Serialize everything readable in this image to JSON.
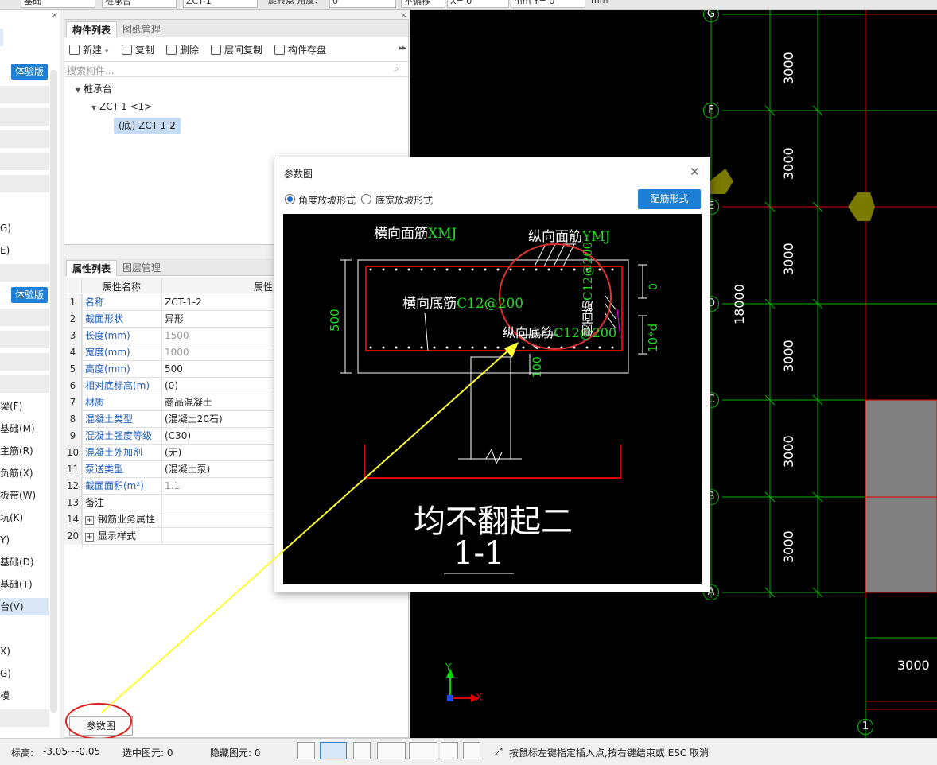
{
  "topbar": {
    "fields": [
      "基础",
      "桩承台",
      "ZCT-1",
      "旋转点 角度:",
      "0",
      "不偏移",
      "X= 0",
      "mm Y= 0",
      "mm"
    ]
  },
  "leftnav": {
    "badge": "体验版",
    "items": [
      "G)",
      "E)",
      "梁(F)",
      "基础(M)",
      "主筋(R)",
      "负筋(X)",
      "板带(W)",
      "坑(K)",
      "Y)",
      "基础(D)",
      "基础(T)",
      "台(V)",
      "X)",
      "G)",
      "模"
    ]
  },
  "component_panel": {
    "tabs": [
      "构件列表",
      "图纸管理"
    ],
    "toolbar": {
      "new": "新建",
      "copy": "复制",
      "delete": "删除",
      "floor_copy": "层间复制",
      "save": "构件存盘"
    },
    "search_placeholder": "搜索构件...",
    "tree": {
      "root": "桩承台",
      "child": "ZCT-1 <1>",
      "leaf": "(底) ZCT-1-2"
    }
  },
  "property_panel": {
    "tabs": [
      "属性列表",
      "图层管理"
    ],
    "col_name": "属性名称",
    "col_value": "属性",
    "rows": [
      {
        "num": "1",
        "name": "名称",
        "value": "ZCT-1-2"
      },
      {
        "num": "2",
        "name": "截面形状",
        "value": "异形"
      },
      {
        "num": "3",
        "name": "长度(mm)",
        "value": "1500"
      },
      {
        "num": "4",
        "name": "宽度(mm)",
        "value": "1000"
      },
      {
        "num": "5",
        "name": "高度(mm)",
        "value": "500"
      },
      {
        "num": "6",
        "name": "相对底标高(m)",
        "value": "(0)"
      },
      {
        "num": "7",
        "name": "材质",
        "value": "商品混凝土"
      },
      {
        "num": "8",
        "name": "混凝土类型",
        "value": "(混凝土20石)"
      },
      {
        "num": "9",
        "name": "混凝土强度等级",
        "value": "(C30)"
      },
      {
        "num": "10",
        "name": "混凝土外加剂",
        "value": "(无)"
      },
      {
        "num": "11",
        "name": "泵送类型",
        "value": "(混凝土泵)"
      },
      {
        "num": "12",
        "name": "截面面积(m²)",
        "value": "1.1"
      },
      {
        "num": "13",
        "name": "备注",
        "value": ""
      },
      {
        "num": "14",
        "name": "钢筋业务属性",
        "value": ""
      },
      {
        "num": "20",
        "name": "显示样式",
        "value": ""
      }
    ],
    "param_button": "参数图"
  },
  "dialog": {
    "title": "参数图",
    "option1": "角度放坡形式",
    "option2": "底宽放坡形式",
    "config_button": "配筋形式",
    "drawing": {
      "top_transverse": "横向面筋",
      "top_transverse_val": "XMJ",
      "top_longitudinal": "纵向面筋",
      "top_longitudinal_val": "YMJ",
      "bottom_transverse": "横向底筋",
      "bottom_transverse_val": "C12@200",
      "bottom_longitudinal": "纵向底筋",
      "bottom_longitudinal_val": "C12@200",
      "side": "侧面筋",
      "side_val": "C12@200",
      "dim_height": "500",
      "dim_zero": "0",
      "dim_10d": "10*d",
      "dim_100": "100",
      "caption": "均不翻起二",
      "section": "1-1"
    }
  },
  "cad": {
    "axes": [
      "G",
      "F",
      "E",
      "D",
      "C",
      "B",
      "A",
      "1"
    ],
    "dims": [
      "3000",
      "3000",
      "3000",
      "3000",
      "3000",
      "3000"
    ],
    "total": "18000",
    "bottom_dim": "3000",
    "ucs_x": "X",
    "ucs_y": "Y"
  },
  "status": {
    "elevation_label": "标高:",
    "elevation_value": "-3.05~-0.05",
    "selected": "选中图元: 0",
    "hidden": "隐藏图元: 0",
    "hint": "按鼠标左键指定插入点,按右键结束或 ESC 取消"
  },
  "colors": {
    "accent": "#1e7fd6",
    "cad_grid": "#00c000",
    "cad_red": "#e00000",
    "annotation": "#ffff33"
  }
}
